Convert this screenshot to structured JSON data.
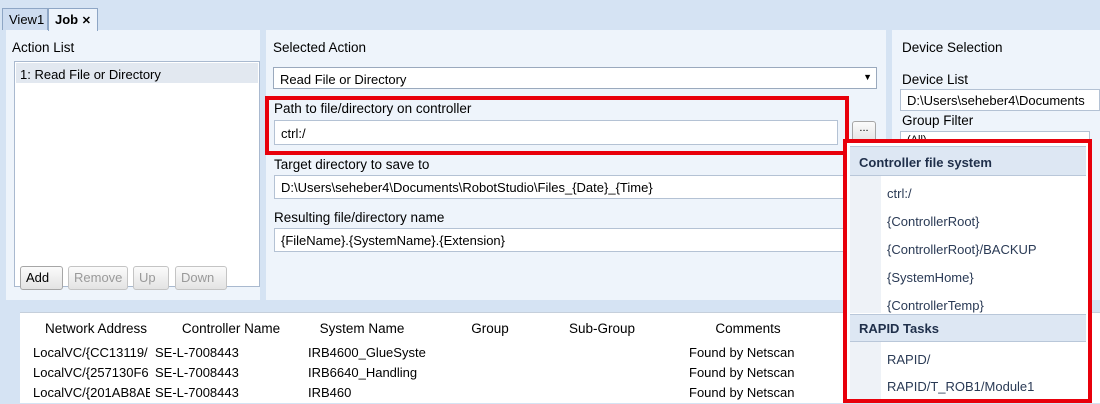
{
  "tabs": [
    {
      "label": "View1",
      "active": false
    },
    {
      "label": "Job",
      "active": true,
      "close_glyph": "✕"
    }
  ],
  "action_list": {
    "header": "Action List",
    "items": [
      "1: Read File or Directory"
    ],
    "buttons": [
      "Add",
      "Remove",
      "Up",
      "Down"
    ]
  },
  "selected_action": {
    "header": "Selected Action",
    "value": "Read File or Directory",
    "path_label": "Path to file/directory on controller",
    "path_value": "ctrl:/",
    "browse_label": "...",
    "target_label": "Target directory to save to",
    "target_value": "D:\\Users\\seheber4\\Documents\\RobotStudio\\Files_{Date}_{Time}",
    "result_label": "Resulting file/directory name",
    "result_value": "{FileName}.{SystemName}.{Extension}"
  },
  "device_selection": {
    "header": "Device Selection",
    "list_label": "Device List",
    "list_value": "D:\\Users\\seheber4\\Documents",
    "filter_label": "Group Filter",
    "filter_value": "(All)"
  },
  "popup": {
    "sections": [
      {
        "title": "Controller file system",
        "items": [
          "ctrl:/",
          "{ControllerRoot}",
          "{ControllerRoot}/BACKUP",
          "{SystemHome}",
          "{ControllerTemp}"
        ]
      },
      {
        "title": "RAPID Tasks",
        "items": [
          "RAPID/",
          "RAPID/T_ROB1/Module1"
        ]
      }
    ]
  },
  "device_grid": {
    "columns": [
      "Network Address",
      "Controller Name",
      "System Name",
      "Group",
      "Sub-Group",
      "Comments"
    ],
    "rows": [
      [
        "LocalVC/{CC13119/",
        "SE-L-7008443",
        "IRB4600_GlueSyste",
        "",
        "",
        "Found by Netscan"
      ],
      [
        "LocalVC/{257130F6",
        "SE-L-7008443",
        "IRB6640_Handling",
        "",
        "",
        "Found by Netscan"
      ],
      [
        "LocalVC/{201AB8AE",
        "SE-L-7008443",
        "IRB460",
        "",
        "",
        "Found by Netscan"
      ]
    ]
  },
  "colors": {
    "highlight": "#e8000b",
    "panel": "#eef4fb",
    "background": "#d5e3f3"
  }
}
